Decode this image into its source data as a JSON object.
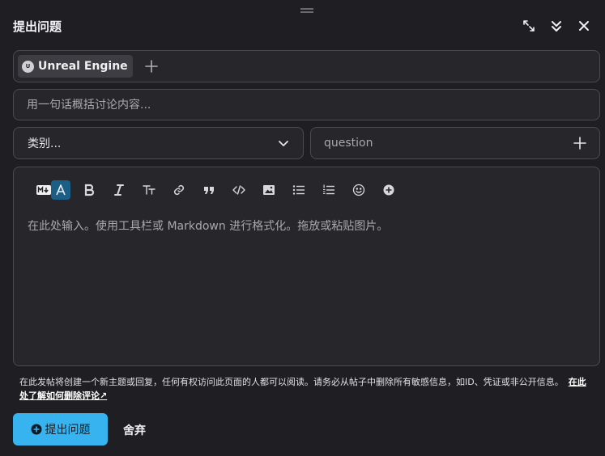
{
  "header": {
    "title": "提出问题",
    "expand_icon": "expand-arrows-icon",
    "collapse_icon": "double-chevron-down-icon",
    "close_icon": "close-icon"
  },
  "tags": {
    "items": [
      {
        "label": "Unreal Engine",
        "icon": "unreal-engine-icon"
      }
    ],
    "add_icon": "plus-icon"
  },
  "title_input": {
    "placeholder": "用一句话概括讨论内容..."
  },
  "category": {
    "selected": "类别...",
    "icon": "chevron-down-icon"
  },
  "tag_input": {
    "placeholder": "question",
    "add_icon": "plus-icon"
  },
  "toolbar": {
    "items": [
      "markdown-mode-icon",
      "rich-text-mode-icon",
      "bold-icon",
      "italic-icon",
      "text-size-icon",
      "link-icon",
      "quote-icon",
      "code-icon",
      "image-icon",
      "bullet-list-icon",
      "numbered-list-icon",
      "emoji-icon",
      "insert-plus-icon"
    ]
  },
  "editor": {
    "placeholder": "在此处输入。使用工具栏或 Markdown 进行格式化。拖放或粘贴图片。"
  },
  "notice": {
    "text": "在此发帖将创建一个新主题或回复，任何有权访问此页面的人都可以阅读。请务必从帖子中删除所有敏感信息，如ID、凭证或非公开信息。",
    "link": "在此处了解如何删除评论↗"
  },
  "actions": {
    "submit": "提出问题",
    "discard": "舍弃"
  },
  "colors": {
    "background": "#1f1f23",
    "accent": "#37b4f0",
    "field_border": "#4a4a50",
    "rich_text_active": "#1b5e86"
  }
}
